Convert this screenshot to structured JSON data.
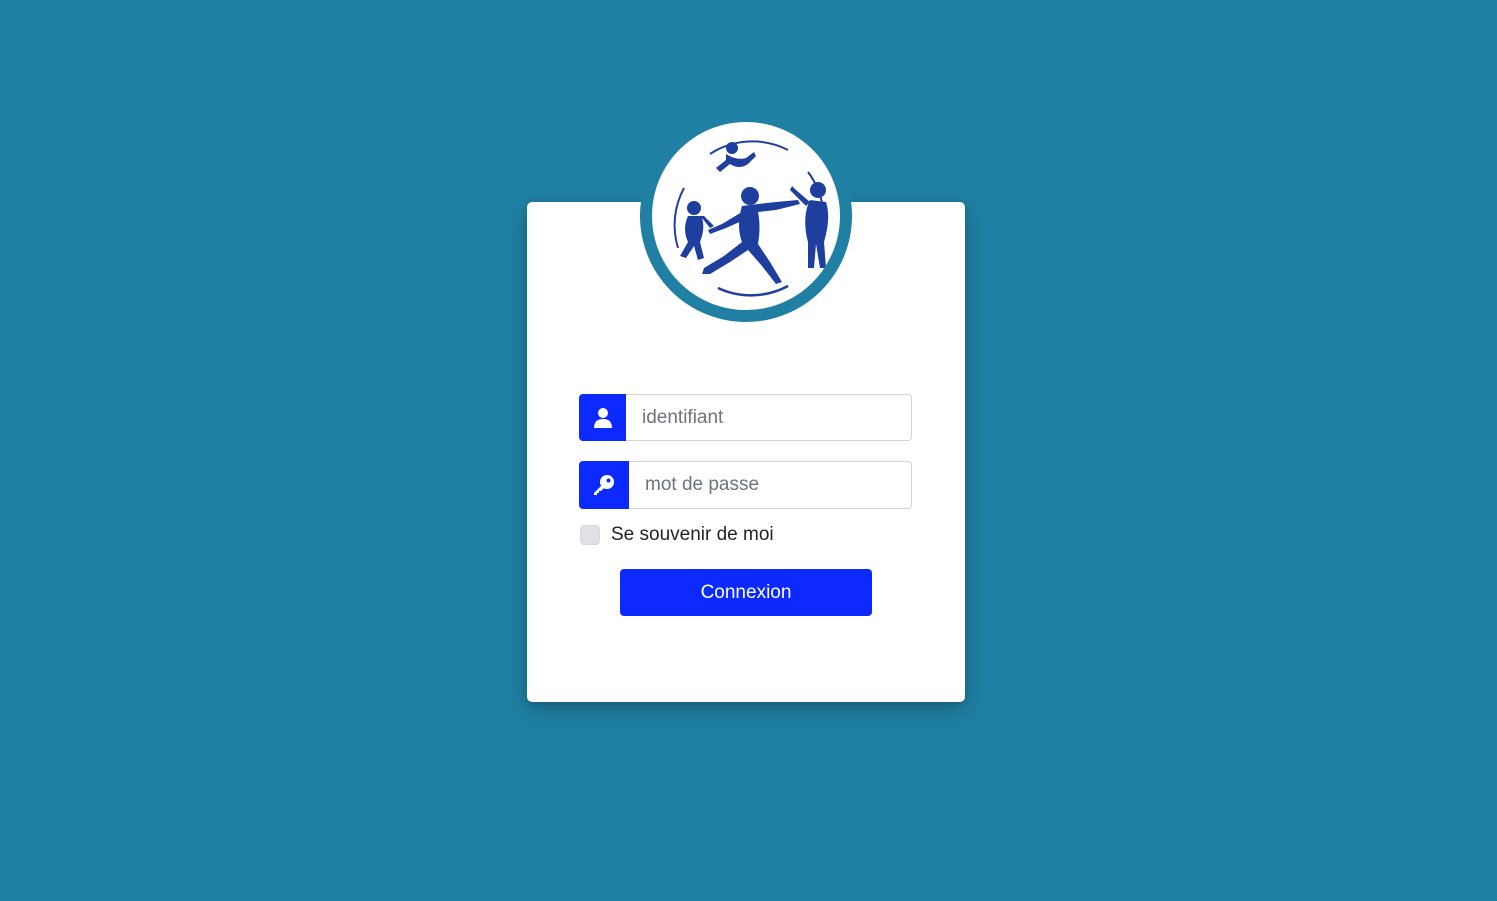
{
  "login": {
    "username_placeholder": "identifiant",
    "password_placeholder": "mot de passe",
    "remember_label": "Se souvenir de moi",
    "submit_label": "Connexion"
  },
  "icons": {
    "username": "user-icon",
    "password": "key-icon",
    "logo": "family-logo"
  },
  "colors": {
    "background": "#1f80a3",
    "accent": "#0c2aff",
    "logo": "#1e3f9e"
  }
}
